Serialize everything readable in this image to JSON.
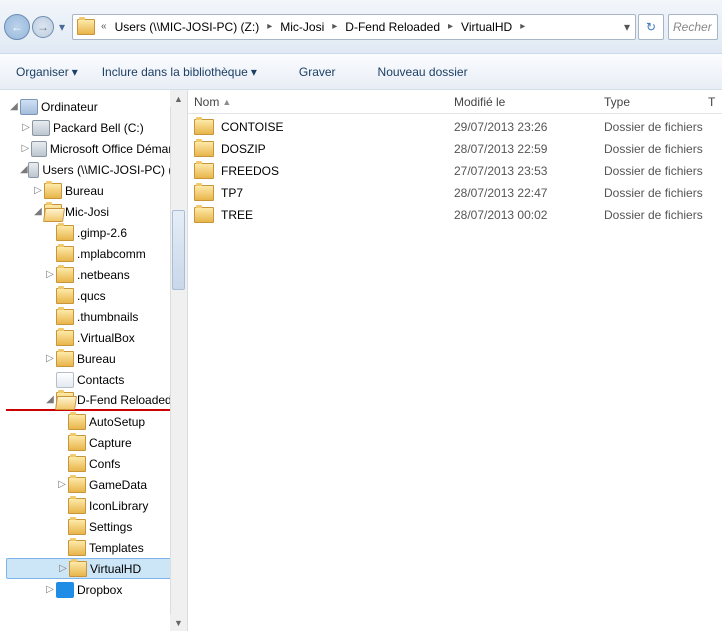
{
  "addressbar": {
    "segments": [
      {
        "label": "Users (\\\\MIC-JOSI-PC) (Z:)",
        "underlined": true
      },
      {
        "label": "Mic-Josi",
        "underlined": true
      },
      {
        "label": "D-Fend Reloaded",
        "underlined": true
      },
      {
        "label": "VirtualHD",
        "underlined": true
      }
    ],
    "overflow_glyph": "«",
    "dropdown_glyph": "▾",
    "refresh_glyph": "↻",
    "search_placeholder": "Recher"
  },
  "nav": {
    "back_glyph": "←",
    "fwd_glyph": "→",
    "hist_glyph": "▾"
  },
  "toolbar": {
    "organize": "Organiser",
    "include": "Inclure dans la bibliothèque",
    "burn": "Graver",
    "newfolder": "Nouveau dossier",
    "drop_glyph": "▾"
  },
  "columns": {
    "name": "Nom",
    "modified": "Modifié le",
    "type": "Type",
    "size_initial": "T",
    "sort_glyph": "▲"
  },
  "files": [
    {
      "name": "CONTOISE",
      "modified": "29/07/2013 23:26",
      "type": "Dossier de fichiers"
    },
    {
      "name": "DOSZIP",
      "modified": "28/07/2013 22:59",
      "type": "Dossier de fichiers"
    },
    {
      "name": "FREEDOS",
      "modified": "27/07/2013 23:53",
      "type": "Dossier de fichiers"
    },
    {
      "name": "TP7",
      "modified": "28/07/2013 22:47",
      "type": "Dossier de fichiers"
    },
    {
      "name": "TREE",
      "modified": "28/07/2013 00:02",
      "type": "Dossier de fichiers"
    }
  ],
  "tree": {
    "root": "Ordinateur",
    "items": {
      "packard": "Packard Bell (C:)",
      "msoffice": "Microsoft Office Démarre",
      "users_z": "Users (\\\\MIC-JOSI-PC) (Z:",
      "bureau": "Bureau",
      "micjosi": "Mic-Josi",
      "gimp": ".gimp-2.6",
      "mplab": ".mplabcomm",
      "netbeans": ".netbeans",
      "qucs": ".qucs",
      "thumbnails": ".thumbnails",
      "virtualbox": ".VirtualBox",
      "bureau2": "Bureau",
      "contacts": "Contacts",
      "dfend": "D-Fend Reloaded",
      "autosetup": "AutoSetup",
      "capture": "Capture",
      "confs": "Confs",
      "gamedata": "GameData",
      "iconlib": "IconLibrary",
      "settings": "Settings",
      "templates": "Templates",
      "virtualhd": "VirtualHD",
      "dropbox": "Dropbox"
    }
  }
}
